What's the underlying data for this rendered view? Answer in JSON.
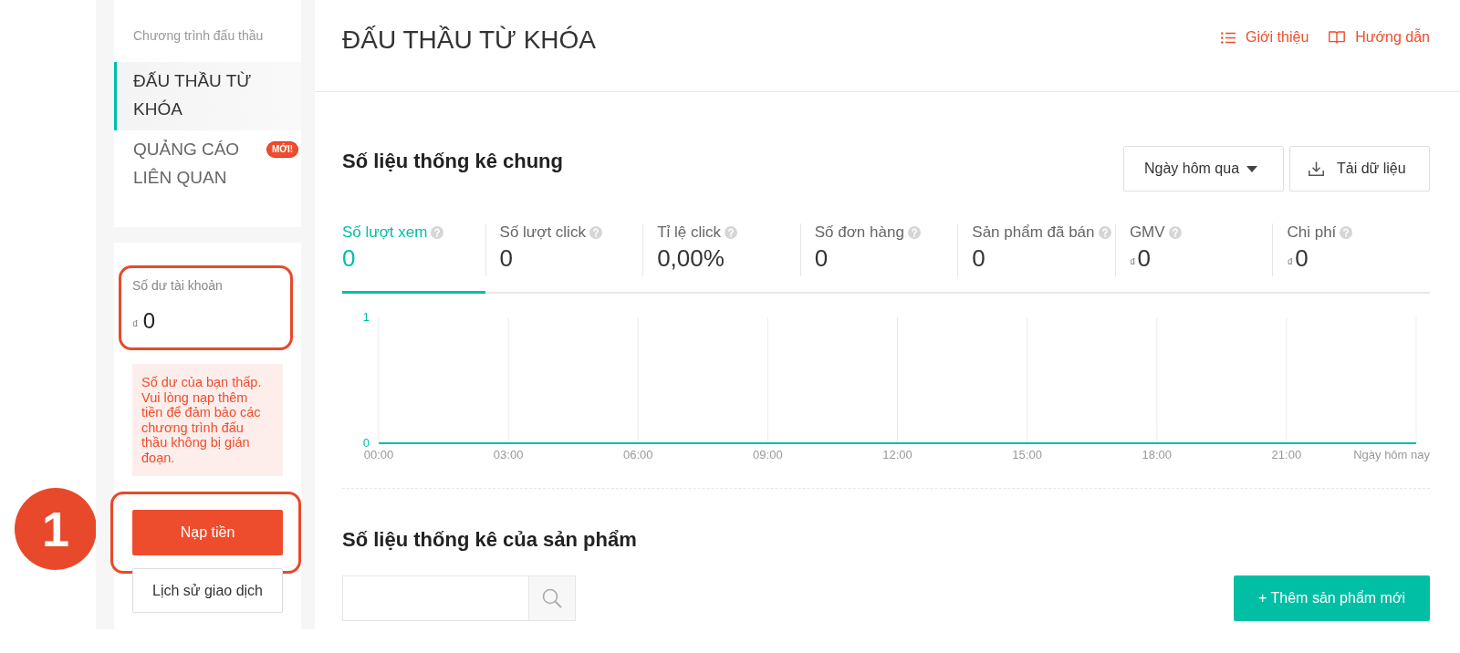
{
  "sidebar": {
    "section_title": "Chương trình đấu thầu",
    "items": [
      {
        "label": "ĐẤU THẦU TỪ KHÓA",
        "selected": true
      },
      {
        "label": "QUẢNG CÁO LIÊN QUAN",
        "selected": false,
        "badge": "MỚI!"
      }
    ]
  },
  "account": {
    "balance": {
      "label": "Số dư tài khoản",
      "currency": "₫",
      "amount": "0",
      "highlighted": true
    },
    "warning": "Số dư của bạn thấp. Vui lòng nạp thêm tiền để đảm bảo các chương trình đấu thầu không bị gián đoạn.",
    "buttons": [
      {
        "label": "Nạp tiền",
        "kind": "primary",
        "highlighted": true
      },
      {
        "label": "Lịch sử giao dịch",
        "kind": "secondary",
        "highlighted": false
      }
    ]
  },
  "step_marker": "1",
  "header": {
    "title": "ĐẤU THẦU TỪ KHÓA",
    "links": [
      {
        "label": "Giới thiệu",
        "kind": "list"
      },
      {
        "label": "Hướng dẫn",
        "kind": "book"
      }
    ]
  },
  "overview": {
    "title": "Số liệu thống kê chung",
    "date_range": "Ngày hôm qua",
    "download_button": "Tải dữ liệu",
    "metrics": [
      {
        "label": "Số lượt xem",
        "value": "0",
        "selected": true
      },
      {
        "label": "Số lượt click",
        "value": "0",
        "selected": false
      },
      {
        "label": "Tỉ lệ click",
        "value": "0,00%",
        "selected": false
      },
      {
        "label": "Số đơn hàng",
        "value": "0",
        "selected": false
      },
      {
        "label": "Sản phẩm đã bán",
        "value": "0",
        "selected": false
      },
      {
        "label": "GMV",
        "currency": "₫",
        "value": "0",
        "selected": false
      },
      {
        "label": "Chi phí",
        "currency": "₫",
        "value": "0",
        "selected": false
      }
    ],
    "chart_data": {
      "type": "line",
      "xlabel": "Ngày hôm nay",
      "x": [
        0,
        24
      ],
      "series": [
        {
          "color": "#00bfa5",
          "values": [
            0,
            0
          ]
        }
      ],
      "xlim": [
        0,
        24
      ],
      "ylim": [
        0,
        1
      ],
      "xticks": [
        {
          "value": 0,
          "label": "00:00"
        },
        {
          "value": 3,
          "label": "03:00"
        },
        {
          "value": 6,
          "label": "06:00"
        },
        {
          "value": 9,
          "label": "09:00"
        },
        {
          "value": 12,
          "label": "12:00"
        },
        {
          "value": 15,
          "label": "15:00"
        },
        {
          "value": 18,
          "label": "18:00"
        },
        {
          "value": 21,
          "label": "21:00"
        }
      ],
      "yticks": [
        0,
        1
      ],
      "grid": true
    }
  },
  "products": {
    "title": "Số liệu thống kê của sản phẩm",
    "add_button": "+ Thêm sản phẩm mới"
  }
}
